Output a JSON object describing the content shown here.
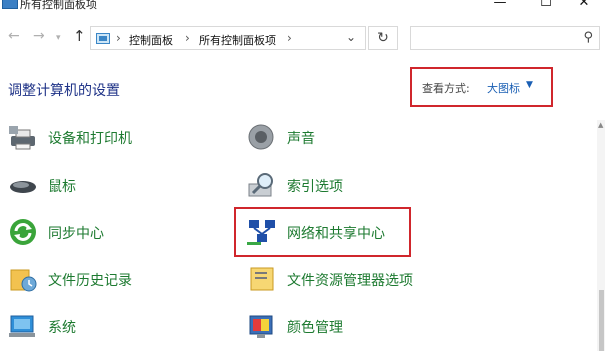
{
  "window": {
    "title": "所有控制面板项",
    "min_glyph": "—",
    "max_glyph": "☐",
    "close_glyph": "✕"
  },
  "nav": {
    "back_glyph": "←",
    "forward_glyph": "→",
    "recent_glyph": "▾",
    "up_glyph": "↑",
    "refresh_glyph": "↻",
    "search_glyph": "⚲"
  },
  "address": {
    "crumbs": [
      "控制面板",
      "所有控制面板项"
    ],
    "separator": "›",
    "dropdown_glyph": "⌄"
  },
  "content": {
    "heading": "调整计算机的设置",
    "view_label": "查看方式:",
    "view_value": "大图标",
    "view_arrow": "▼"
  },
  "items": [
    {
      "label": "设备和打印机",
      "icon": "printer-icon"
    },
    {
      "label": "声音",
      "icon": "speaker-icon"
    },
    {
      "label": "鼠标",
      "icon": "mouse-icon"
    },
    {
      "label": "索引选项",
      "icon": "indexing-icon"
    },
    {
      "label": "同步中心",
      "icon": "sync-icon"
    },
    {
      "label": "网络和共享中心",
      "icon": "network-icon"
    },
    {
      "label": "文件历史记录",
      "icon": "file-history-icon"
    },
    {
      "label": "文件资源管理器选项",
      "icon": "folder-options-icon"
    },
    {
      "label": "系统",
      "icon": "system-icon"
    },
    {
      "label": "颜色管理",
      "icon": "color-management-icon"
    }
  ],
  "colors": {
    "link_green": "#1d7a30",
    "heading_blue": "#1e3287",
    "highlight_red": "#d0262c",
    "accent_blue": "#1a5fb4"
  }
}
